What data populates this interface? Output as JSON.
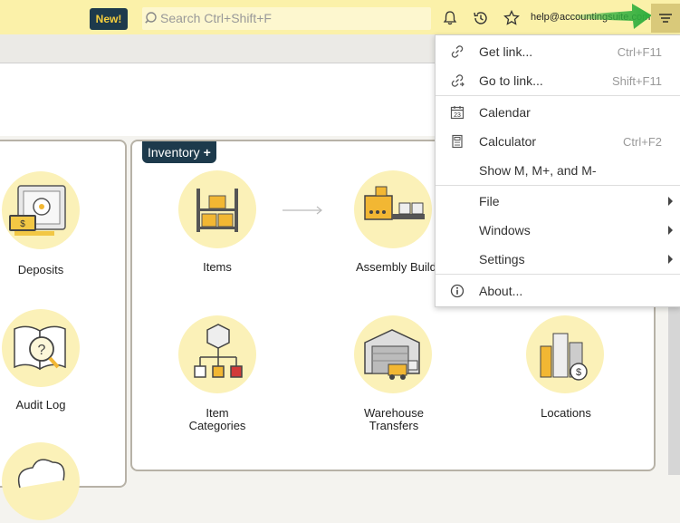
{
  "header": {
    "new_badge": "New!",
    "search_placeholder": "Search Ctrl+Shift+F",
    "email": "help@accountingsuite.com"
  },
  "left_panel": {
    "tiles": [
      {
        "label": "Deposits"
      },
      {
        "label": "Audit Log"
      }
    ]
  },
  "inventory": {
    "title": "Inventory",
    "tiles": [
      {
        "label": "Items"
      },
      {
        "label": "Assembly Builds"
      },
      {
        "label_line1": "Item",
        "label_line2": "Categories"
      },
      {
        "label_line1": "Warehouse",
        "label_line2": "Transfers"
      },
      {
        "label": "Locations"
      }
    ]
  },
  "menu": {
    "items": [
      {
        "label": "Get link...",
        "shortcut": "Ctrl+F11",
        "icon": "link-icon"
      },
      {
        "label": "Go to link...",
        "shortcut": "Shift+F11",
        "icon": "go-to-link-icon"
      },
      {
        "label": "Calendar",
        "shortcut": "",
        "icon": "calendar-icon",
        "icon_text": "23"
      },
      {
        "label": "Calculator",
        "shortcut": "Ctrl+F2",
        "icon": "calculator-icon"
      },
      {
        "label": "Show M, M+, and M-",
        "shortcut": ""
      },
      {
        "label": "File",
        "submenu": true
      },
      {
        "label": "Windows",
        "submenu": true
      },
      {
        "label": "Settings",
        "submenu": true
      },
      {
        "label": "About...",
        "icon": "info-icon"
      }
    ]
  },
  "colors": {
    "topbar": "#fbf1a9",
    "navy": "#1d3a4c",
    "accent_yellow": "#f7cf3d",
    "tile_bg": "#fbf1b8",
    "arrow_green": "#2fae3d"
  }
}
